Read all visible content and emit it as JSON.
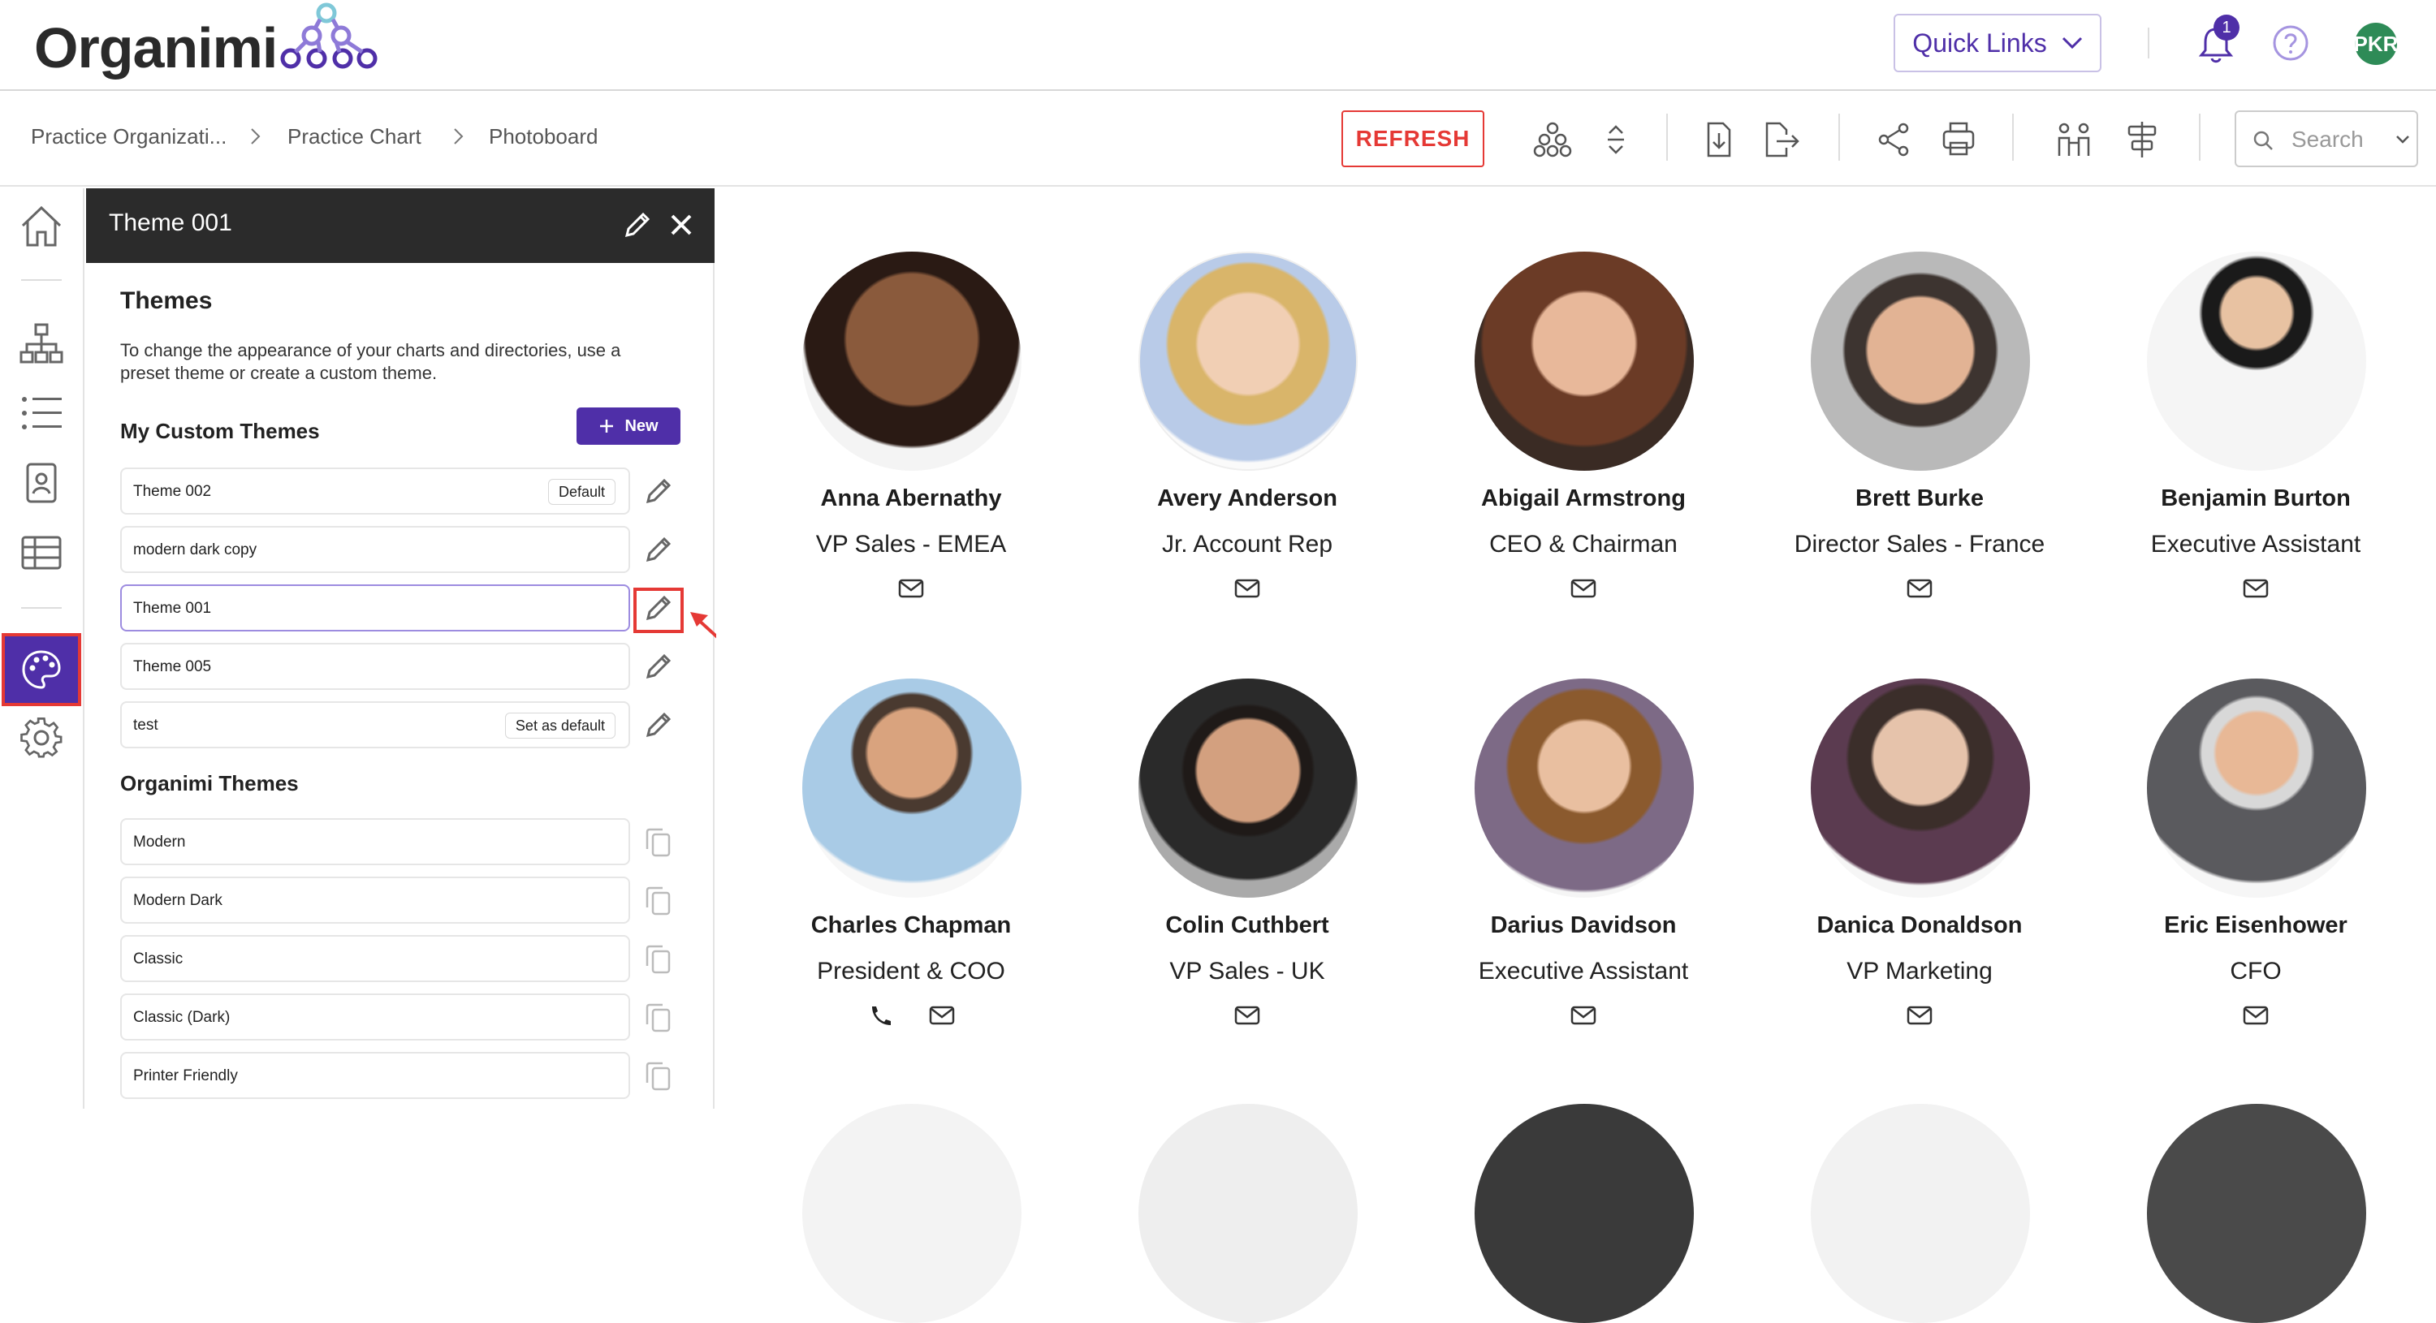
{
  "header": {
    "brand": "Organimi",
    "quick_links": "Quick Links",
    "notifications_count": "1",
    "avatar_initials": "PKR"
  },
  "breadcrumb": [
    "Practice Organizati...",
    "Practice Chart",
    "Photoboard"
  ],
  "toolbar": {
    "refresh": "REFRESH",
    "search_placeholder": "Search"
  },
  "panel": {
    "title": "Theme 001",
    "heading": "Themes",
    "description": "To change the appearance of your charts and directories, use a preset theme or create a custom theme.",
    "custom_heading": "My Custom Themes",
    "new_button": "New",
    "custom_themes": [
      {
        "name": "Theme 002",
        "badge": "Default"
      },
      {
        "name": "modern dark copy",
        "badge": ""
      },
      {
        "name": "Theme 001",
        "badge": ""
      },
      {
        "name": "Theme 005",
        "badge": ""
      },
      {
        "name": "test",
        "badge": "Set as default"
      }
    ],
    "organimi_heading": "Organimi Themes",
    "organimi_themes": [
      "Modern",
      "Modern Dark",
      "Classic",
      "Classic (Dark)",
      "Printer Friendly"
    ]
  },
  "people": [
    {
      "name": "Anna Abernathy",
      "title": "VP Sales - EMEA"
    },
    {
      "name": "Avery Anderson",
      "title": "Jr. Account Rep"
    },
    {
      "name": "Abigail Armstrong",
      "title": "CEO & Chairman"
    },
    {
      "name": "Brett Burke",
      "title": "Director Sales - France"
    },
    {
      "name": "Benjamin Burton",
      "title": "Executive Assistant"
    },
    {
      "name": "Charles Chapman",
      "title": "President & COO"
    },
    {
      "name": "Colin Cuthbert",
      "title": "VP Sales - UK"
    },
    {
      "name": "Darius Davidson",
      "title": "Executive Assistant"
    },
    {
      "name": "Danica Donaldson",
      "title": "VP Marketing"
    },
    {
      "name": "Eric Eisenhower",
      "title": "CFO"
    }
  ],
  "colors": {
    "accent": "#4f2fa8",
    "highlight": "#e53935",
    "panel_header": "#2b2b2b"
  },
  "icons": {
    "nav": [
      "home-icon",
      "org-chart-icon",
      "list-icon",
      "directory-icon",
      "table-icon",
      "palette-icon",
      "gear-icon"
    ],
    "toolbar": [
      "chart-layout-icon",
      "expand-collapse-icon",
      "download-icon",
      "export-icon",
      "share-icon",
      "print-icon",
      "people-icon",
      "align-icon"
    ]
  }
}
